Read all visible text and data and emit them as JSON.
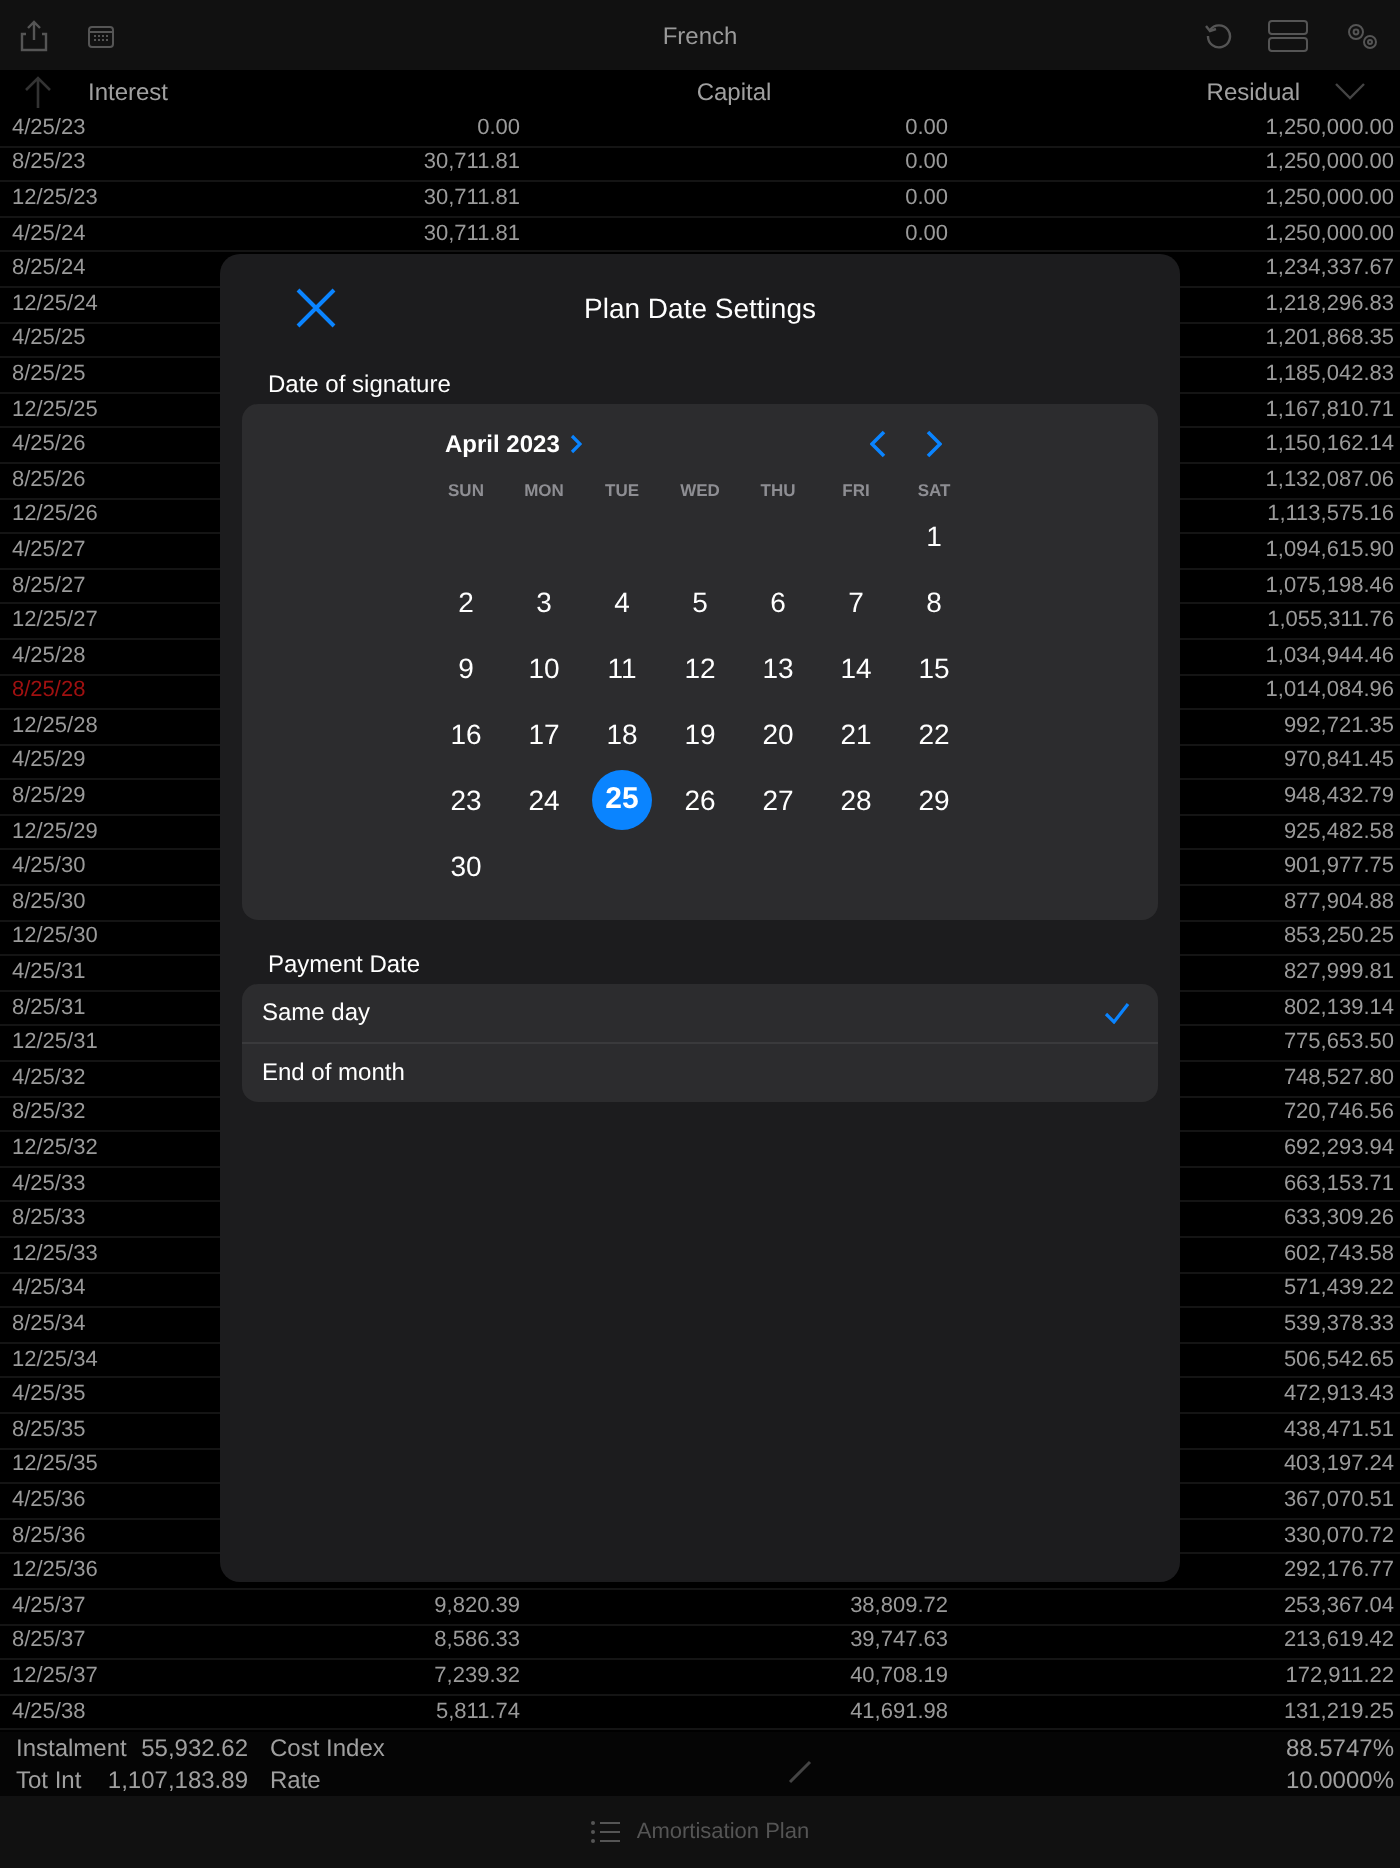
{
  "top_bar": {
    "title": "French"
  },
  "table": {
    "columns": [
      "Interest",
      "Capital",
      "Residual"
    ],
    "rows": [
      {
        "date": "4/25/23",
        "interest": "0.00",
        "capital": "0.00",
        "residual": "1,250,000.00",
        "marked": false
      },
      {
        "date": "8/25/23",
        "interest": "30,711.81",
        "capital": "0.00",
        "residual": "1,250,000.00",
        "marked": false
      },
      {
        "date": "12/25/23",
        "interest": "30,711.81",
        "capital": "0.00",
        "residual": "1,250,000.00",
        "marked": false
      },
      {
        "date": "4/25/24",
        "interest": "30,711.81",
        "capital": "0.00",
        "residual": "1,250,000.00",
        "marked": false
      },
      {
        "date": "8/25/24",
        "residual": "1,234,337.67",
        "marked": false
      },
      {
        "date": "12/25/24",
        "residual": "1,218,296.83",
        "marked": false
      },
      {
        "date": "4/25/25",
        "residual": "1,201,868.35",
        "marked": false
      },
      {
        "date": "8/25/25",
        "residual": "1,185,042.83",
        "marked": false
      },
      {
        "date": "12/25/25",
        "residual": "1,167,810.71",
        "marked": false
      },
      {
        "date": "4/25/26",
        "residual": "1,150,162.14",
        "marked": false
      },
      {
        "date": "8/25/26",
        "residual": "1,132,087.06",
        "marked": false
      },
      {
        "date": "12/25/26",
        "residual": "1,113,575.16",
        "marked": false
      },
      {
        "date": "4/25/27",
        "residual": "1,094,615.90",
        "marked": false
      },
      {
        "date": "8/25/27",
        "residual": "1,075,198.46",
        "marked": false
      },
      {
        "date": "12/25/27",
        "residual": "1,055,311.76",
        "marked": false
      },
      {
        "date": "4/25/28",
        "residual": "1,034,944.46",
        "marked": false
      },
      {
        "date": "8/25/28",
        "residual": "1,014,084.96",
        "marked": true
      },
      {
        "date": "12/25/28",
        "residual": "992,721.35",
        "marked": false
      },
      {
        "date": "4/25/29",
        "residual": "970,841.45",
        "marked": false
      },
      {
        "date": "8/25/29",
        "residual": "948,432.79",
        "marked": false
      },
      {
        "date": "12/25/29",
        "residual": "925,482.58",
        "marked": false
      },
      {
        "date": "4/25/30",
        "residual": "901,977.75",
        "marked": false
      },
      {
        "date": "8/25/30",
        "residual": "877,904.88",
        "marked": false
      },
      {
        "date": "12/25/30",
        "residual": "853,250.25",
        "marked": false
      },
      {
        "date": "4/25/31",
        "residual": "827,999.81",
        "marked": false
      },
      {
        "date": "8/25/31",
        "residual": "802,139.14",
        "marked": false
      },
      {
        "date": "12/25/31",
        "residual": "775,653.50",
        "marked": false
      },
      {
        "date": "4/25/32",
        "residual": "748,527.80",
        "marked": false
      },
      {
        "date": "8/25/32",
        "residual": "720,746.56",
        "marked": false
      },
      {
        "date": "12/25/32",
        "residual": "692,293.94",
        "marked": false
      },
      {
        "date": "4/25/33",
        "residual": "663,153.71",
        "marked": false
      },
      {
        "date": "8/25/33",
        "residual": "633,309.26",
        "marked": false
      },
      {
        "date": "12/25/33",
        "residual": "602,743.58",
        "marked": false
      },
      {
        "date": "4/25/34",
        "residual": "571,439.22",
        "marked": false
      },
      {
        "date": "8/25/34",
        "residual": "539,378.33",
        "marked": false
      },
      {
        "date": "12/25/34",
        "residual": "506,542.65",
        "marked": false
      },
      {
        "date": "4/25/35",
        "residual": "472,913.43",
        "marked": false
      },
      {
        "date": "8/25/35",
        "residual": "438,471.51",
        "marked": false
      },
      {
        "date": "12/25/35",
        "residual": "403,197.24",
        "marked": false
      },
      {
        "date": "4/25/36",
        "residual": "367,070.51",
        "marked": false
      },
      {
        "date": "8/25/36",
        "residual": "330,070.72",
        "marked": false
      },
      {
        "date": "12/25/36",
        "residual": "292,176.77",
        "marked": false
      },
      {
        "date": "4/25/37",
        "interest": "9,820.39",
        "capital": "38,809.72",
        "residual": "253,367.04",
        "marked": false
      },
      {
        "date": "8/25/37",
        "interest": "8,586.33",
        "capital": "39,747.63",
        "residual": "213,619.42",
        "marked": false
      },
      {
        "date": "12/25/37",
        "interest": "7,239.32",
        "capital": "40,708.19",
        "residual": "172,911.22",
        "marked": false
      },
      {
        "date": "4/25/38",
        "interest": "5,811.74",
        "capital": "41,691.98",
        "residual": "131,219.25",
        "marked": false
      }
    ]
  },
  "summary": {
    "rows": [
      {
        "label": "Instalment",
        "value": "55,932.62",
        "metric": "Cost Index",
        "metric_value": "88.5747%"
      },
      {
        "label": "Tot Int",
        "value": "1,107,183.89",
        "metric": "Rate",
        "metric_value": "10.0000%"
      }
    ]
  },
  "tab_bar": {
    "label": "Amortisation Plan"
  },
  "dialog": {
    "title": "Plan Date Settings",
    "signature_label": "Date of signature",
    "calendar": {
      "month": "April 2023",
      "weekdays": [
        "SUN",
        "MON",
        "TUE",
        "WED",
        "THU",
        "FRI",
        "SAT"
      ],
      "weeks": [
        [
          {
            "day": "1",
            "selected": false
          }
        ],
        [
          {
            "day": "2",
            "selected": false
          },
          {
            "day": "3",
            "selected": false
          },
          {
            "day": "4",
            "selected": false
          },
          {
            "day": "5",
            "selected": false
          },
          {
            "day": "6",
            "selected": false
          },
          {
            "day": "7",
            "selected": false
          },
          {
            "day": "8",
            "selected": false
          }
        ],
        [
          {
            "day": "9",
            "selected": false
          },
          {
            "day": "10",
            "selected": false
          },
          {
            "day": "11",
            "selected": false
          },
          {
            "day": "12",
            "selected": false
          },
          {
            "day": "13",
            "selected": false
          },
          {
            "day": "14",
            "selected": false
          },
          {
            "day": "15",
            "selected": false
          }
        ],
        [
          {
            "day": "16",
            "selected": false
          },
          {
            "day": "17",
            "selected": false
          },
          {
            "day": "18",
            "selected": false
          },
          {
            "day": "19",
            "selected": false
          },
          {
            "day": "20",
            "selected": false
          },
          {
            "day": "21",
            "selected": false
          },
          {
            "day": "22",
            "selected": false
          }
        ],
        [
          {
            "day": "23",
            "selected": false
          },
          {
            "day": "24",
            "selected": false
          },
          {
            "day": "25",
            "selected": true
          },
          {
            "day": "26",
            "selected": false
          },
          {
            "day": "27",
            "selected": false
          },
          {
            "day": "28",
            "selected": false
          },
          {
            "day": "29",
            "selected": false
          }
        ],
        [
          {
            "day": "30",
            "selected": false
          }
        ]
      ]
    },
    "payment_label": "Payment Date",
    "payment_options": [
      {
        "label": "Same day",
        "selected": true
      },
      {
        "label": "End of month",
        "selected": false
      }
    ]
  }
}
